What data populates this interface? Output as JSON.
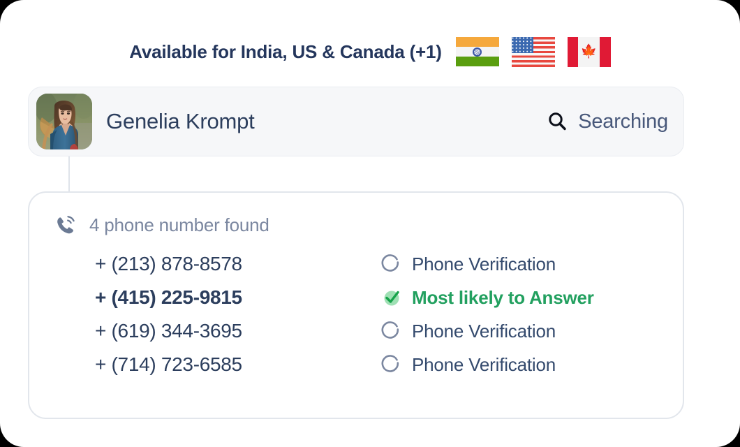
{
  "header": {
    "title": "Available for India, US & Canada (+1)",
    "flags": [
      {
        "name": "india-flag",
        "country": "India"
      },
      {
        "name": "us-flag",
        "country": "United States"
      },
      {
        "name": "canada-flag",
        "country": "Canada"
      }
    ]
  },
  "profile": {
    "avatar_alt": "Profile photo of a young woman with long brown hair wearing a denim jacket",
    "name": "Genelia Krompt",
    "status_icon": "search-icon",
    "status_label": "Searching"
  },
  "results": {
    "found_icon": "phone-ring-icon",
    "found_label": "4 phone number found",
    "rows": [
      {
        "number": "+ (213) 878-8578",
        "status_label": "Phone Verification",
        "status_icon": "spinner-icon",
        "primary": false
      },
      {
        "number": "+ (415) 225-9815",
        "status_label": "Most likely to Answer",
        "status_icon": "check-circle-icon",
        "primary": true
      },
      {
        "number": "+ (619) 344-3695",
        "status_label": "Phone Verification",
        "status_icon": "spinner-icon",
        "primary": false
      },
      {
        "number": "+ (714) 723-6585",
        "status_label": "Phone Verification",
        "status_icon": "spinner-icon",
        "primary": false
      }
    ]
  },
  "colors": {
    "title_navy": "#24365c",
    "body_navy": "#2c3e5d",
    "muted": "#7b87a0",
    "success_green": "#22a05f",
    "success_green_light": "#9fe0b4",
    "card_gray": "#f6f7f9",
    "border": "#e2e6ec"
  }
}
